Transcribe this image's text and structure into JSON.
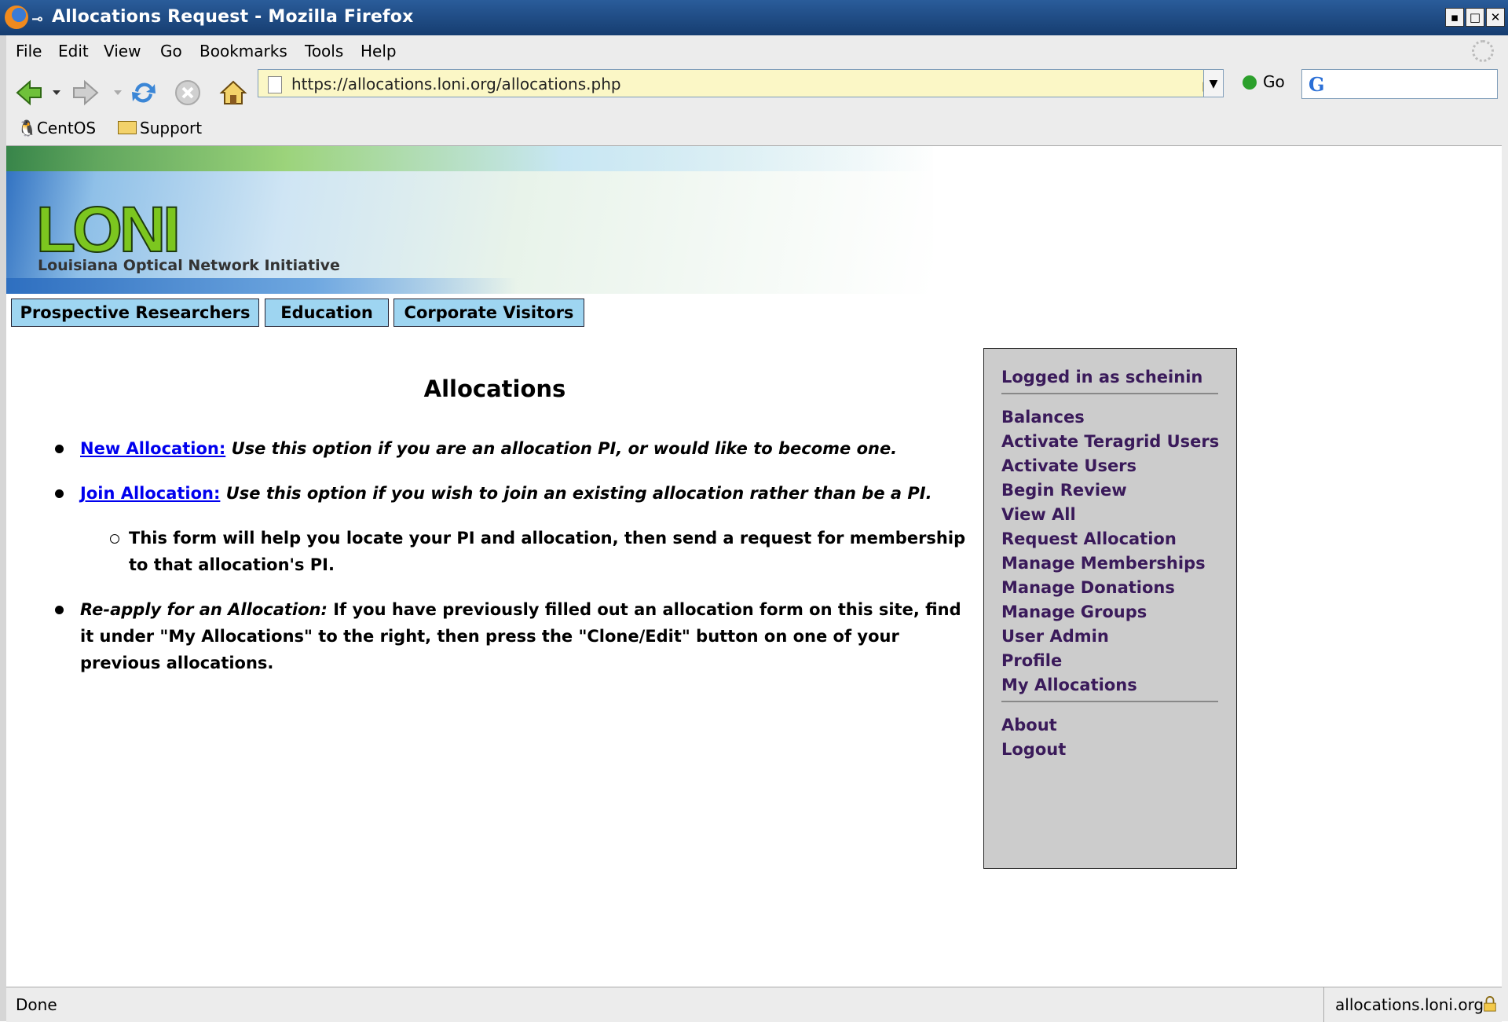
{
  "window": {
    "title": "Allocations Request - Mozilla Firefox"
  },
  "menubar": {
    "items": [
      "File",
      "Edit",
      "View",
      "Go",
      "Bookmarks",
      "Tools",
      "Help"
    ]
  },
  "navbar": {
    "url": "https://allocations.loni.org/allocations.php",
    "go_label": "Go",
    "search_engine_icon": "google-icon"
  },
  "bookmarks": {
    "items": [
      "CentOS",
      "Support"
    ]
  },
  "site": {
    "logo": "LONI",
    "logo_sub": "Louisiana Optical Network Initiative",
    "topnav": [
      "Prospective Researchers",
      "Education",
      "Corporate Visitors"
    ]
  },
  "main": {
    "title": "Allocations",
    "options": [
      {
        "link": "New Allocation:",
        "desc": "Use this option if you are an allocation PI, or would like to become one."
      },
      {
        "link": "Join Allocation:",
        "desc": "Use this option if you wish to join an existing allocation rather than be a PI.",
        "sub": "This form will help you locate your PI and allocation, then send a request for membership to that allocation's PI."
      },
      {
        "label": "Re-apply for an Allocation:",
        "desc": "If you have previously filled out an allocation form on this site, find it under \"My Allocations\" to the right, then press the \"Clone/Edit\" button on one of your previous allocations."
      }
    ]
  },
  "sidebar": {
    "logged_in": "Logged in as scheinin",
    "items": [
      "Balances",
      "Activate Teragrid Users",
      "Activate Users",
      "Begin Review",
      "View All",
      "Request Allocation",
      "Manage Memberships",
      "Manage Donations",
      "Manage Groups",
      "User Admin",
      "Profile",
      "My Allocations"
    ],
    "footer_items": [
      "About",
      "Logout"
    ]
  },
  "statusbar": {
    "status": "Done",
    "host": "allocations.loni.org"
  }
}
